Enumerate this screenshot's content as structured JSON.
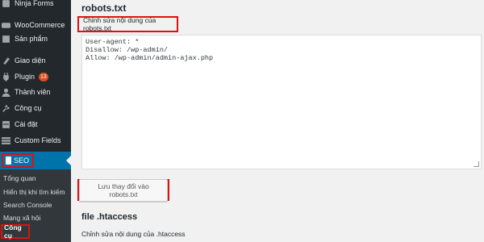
{
  "sidebar": {
    "items": [
      {
        "label": "Ninja Forms",
        "icon": "ninja-forms-icon"
      },
      {
        "label": "WooCommerce",
        "icon": "woocommerce-icon"
      },
      {
        "label": "Sản phẩm",
        "icon": "products-icon"
      },
      {
        "label": "Giao diện",
        "icon": "appearance-icon"
      },
      {
        "label": "Plugin",
        "icon": "plugin-icon",
        "badge": "13"
      },
      {
        "label": "Thành viên",
        "icon": "users-icon"
      },
      {
        "label": "Công cụ",
        "icon": "tools-icon"
      },
      {
        "label": "Cài đặt",
        "icon": "settings-icon"
      },
      {
        "label": "Custom Fields",
        "icon": "custom-fields-icon"
      }
    ],
    "seo": {
      "label": "SEO",
      "icon": "yoast-icon"
    },
    "submenu": [
      "Tổng quan",
      "Hiển thị khi tìm kiếm",
      "Search Console",
      "Mạng xã hội",
      "Công cụ"
    ]
  },
  "main": {
    "title": "robots.txt",
    "edit_label": "Chỉnh sửa nội dung của robots.txt",
    "robots_lines": [
      "User-agent: *",
      "Disallow: /wp-admin/",
      "Allow: /wp-admin/admin-ajax.php"
    ],
    "save_label": "Lưu thay đổi vào robots.txt",
    "htaccess_title": "file .htaccess",
    "htaccess_desc": "Chỉnh sửa nội dung của .htaccess"
  },
  "colors": {
    "sidebar": "#23282d",
    "active": "#0073aa",
    "highlight": "#d11111",
    "badge": "#d54e21"
  }
}
